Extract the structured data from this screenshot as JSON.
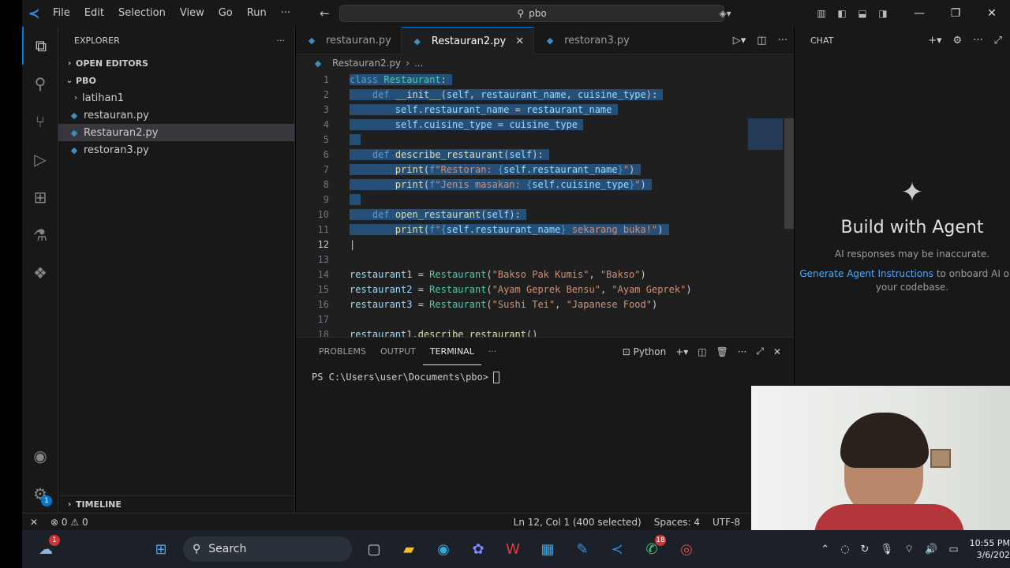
{
  "titlebar": {
    "menu": [
      "File",
      "Edit",
      "Selection",
      "View",
      "Go",
      "Run",
      "···"
    ],
    "search_text": "pbo"
  },
  "sidebar": {
    "title": "EXPLORER",
    "open_editors": "OPEN EDITORS",
    "folder": "PBO",
    "items": [
      {
        "label": "latihan1",
        "type": "folder"
      },
      {
        "label": "restauran.py",
        "type": "py"
      },
      {
        "label": "Restauran2.py",
        "type": "py",
        "selected": true
      },
      {
        "label": "restoran3.py",
        "type": "py"
      }
    ],
    "timeline": "TIMELINE"
  },
  "tabs": [
    {
      "label": "restauran.py",
      "active": false
    },
    {
      "label": "Restauran2.py",
      "active": true
    },
    {
      "label": "restoran3.py",
      "active": false
    }
  ],
  "breadcrumb": {
    "file": "Restauran2.py",
    "more": "..."
  },
  "code": {
    "line_numbers": [
      "1",
      "2",
      "3",
      "4",
      "5",
      "6",
      "7",
      "8",
      "9",
      "10",
      "11",
      "12",
      "13",
      "14",
      "15",
      "16",
      "17",
      "18"
    ],
    "current_line": "12"
  },
  "panel": {
    "tabs": [
      "PROBLEMS",
      "OUTPUT",
      "TERMINAL",
      "···"
    ],
    "active_tab": "TERMINAL",
    "shell": "Python",
    "prompt": "PS C:\\Users\\user\\Documents\\pbo>"
  },
  "chat": {
    "header": "CHAT",
    "title": "Build with Agent",
    "subtitle": "AI responses may be inaccurate.",
    "link": "Generate Agent Instructions",
    "desc_rest": "to onboard AI onto your codebase."
  },
  "statusbar": {
    "errors": "0",
    "warnings": "0",
    "position": "Ln 12, Col 1 (400 selected)",
    "spaces": "Spaces: 4",
    "encoding": "UTF-8"
  },
  "taskbar": {
    "search": "Search",
    "whatsapp_badge": "18",
    "weather_badge": "1",
    "time": "10:55 PM",
    "date": "3/6/202"
  },
  "colors": {
    "accent": "#0078d4",
    "selection": "#264f78",
    "keyword": "#569cd6",
    "class": "#4ec9b0",
    "function": "#dcdcaa",
    "string": "#ce9178",
    "variable": "#9cdcfe"
  }
}
